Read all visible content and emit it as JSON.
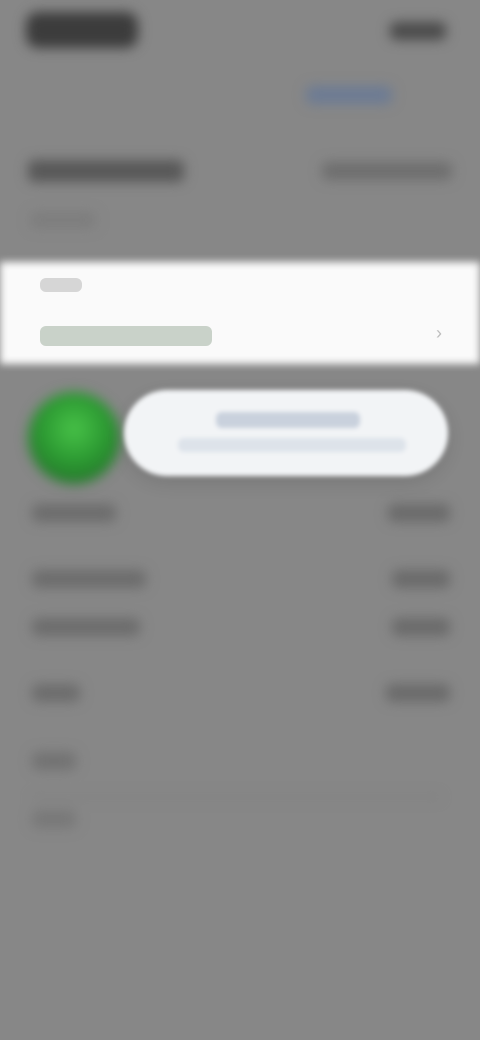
{
  "status_bar": {
    "time": "",
    "indicators": ""
  },
  "header": {
    "action": ""
  },
  "summary": {
    "label": "",
    "value": "",
    "sublabel": ""
  },
  "band": {
    "small": "",
    "title": "",
    "chevron": "›"
  },
  "rows": [
    {
      "label": "",
      "value": ""
    },
    {
      "label": "",
      "value": ""
    },
    {
      "label": "",
      "value": ""
    },
    {
      "label": "",
      "value": ""
    },
    {
      "label": "",
      "value": ""
    }
  ],
  "footer": {
    "label1": "",
    "label2": ""
  },
  "toast": {
    "line1": "",
    "line2": ""
  },
  "colors": {
    "overlay": "#878787",
    "toast_bg": "#f2f4f6",
    "accent_green": "#2c9a32"
  },
  "icons": {
    "app_icon": "green-circle-icon",
    "chevron": "chevron-right-icon"
  }
}
